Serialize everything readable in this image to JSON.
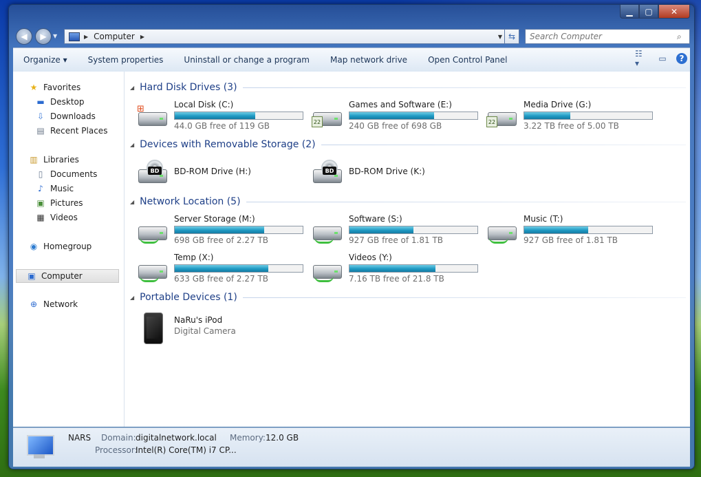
{
  "window": {
    "controls": {
      "minimize": "▁",
      "maximize": "▢",
      "close": "✕"
    }
  },
  "address": {
    "path": "Computer",
    "search_placeholder": "Search Computer"
  },
  "toolbar": {
    "organize": "Organize ▾",
    "system_properties": "System properties",
    "uninstall": "Uninstall or change a program",
    "map_network_drive": "Map network drive",
    "open_control_panel": "Open Control Panel"
  },
  "nav": {
    "favorites": "Favorites",
    "desktop": "Desktop",
    "downloads": "Downloads",
    "recent_places": "Recent Places",
    "libraries": "Libraries",
    "documents": "Documents",
    "music": "Music",
    "pictures": "Pictures",
    "videos": "Videos",
    "homegroup": "Homegroup",
    "computer": "Computer",
    "network": "Network"
  },
  "groups": {
    "hard_disk": "Hard Disk Drives (3)",
    "removable": "Devices with Removable Storage (2)",
    "network": "Network Location (5)",
    "portable": "Portable Devices (1)"
  },
  "drives": {
    "c": {
      "name": "Local Disk (C:)",
      "free": "44.0 GB free of 119 GB",
      "used_fraction": 0.63
    },
    "e": {
      "name": "Games and Software (E:)",
      "free": "240 GB free of 698 GB",
      "used_fraction": 0.66
    },
    "g": {
      "name": "Media Drive (G:)",
      "free": "3.22 TB free of 5.00 TB",
      "used_fraction": 0.36
    },
    "h": {
      "name": "BD-ROM Drive (H:)"
    },
    "k": {
      "name": "BD-ROM Drive (K:)"
    },
    "m": {
      "name": "Server Storage (M:)",
      "free": "698 GB free of 2.27 TB",
      "used_fraction": 0.7
    },
    "s": {
      "name": "Software (S:)",
      "free": "927 GB free of 1.81 TB",
      "used_fraction": 0.5
    },
    "t": {
      "name": "Music (T:)",
      "free": "927 GB free of 1.81 TB",
      "used_fraction": 0.5
    },
    "x": {
      "name": "Temp (X:)",
      "free": "633 GB free of 2.27 TB",
      "used_fraction": 0.73
    },
    "y": {
      "name": "Videos (Y:)",
      "free": "7.16 TB free of 21.8 TB",
      "used_fraction": 0.67
    }
  },
  "portable": {
    "name": "NaRu's iPod",
    "type": "Digital Camera"
  },
  "details": {
    "computer_name": "NARS",
    "domain_label": "Domain:",
    "domain_value": "digitalnetwork.local",
    "memory_label": "Memory:",
    "memory_value": "12.0 GB",
    "processor_label": "Processor:",
    "processor_value": "Intel(R) Core(TM) i7 CP..."
  },
  "bd_badge": "BD",
  "badge_22": "22"
}
